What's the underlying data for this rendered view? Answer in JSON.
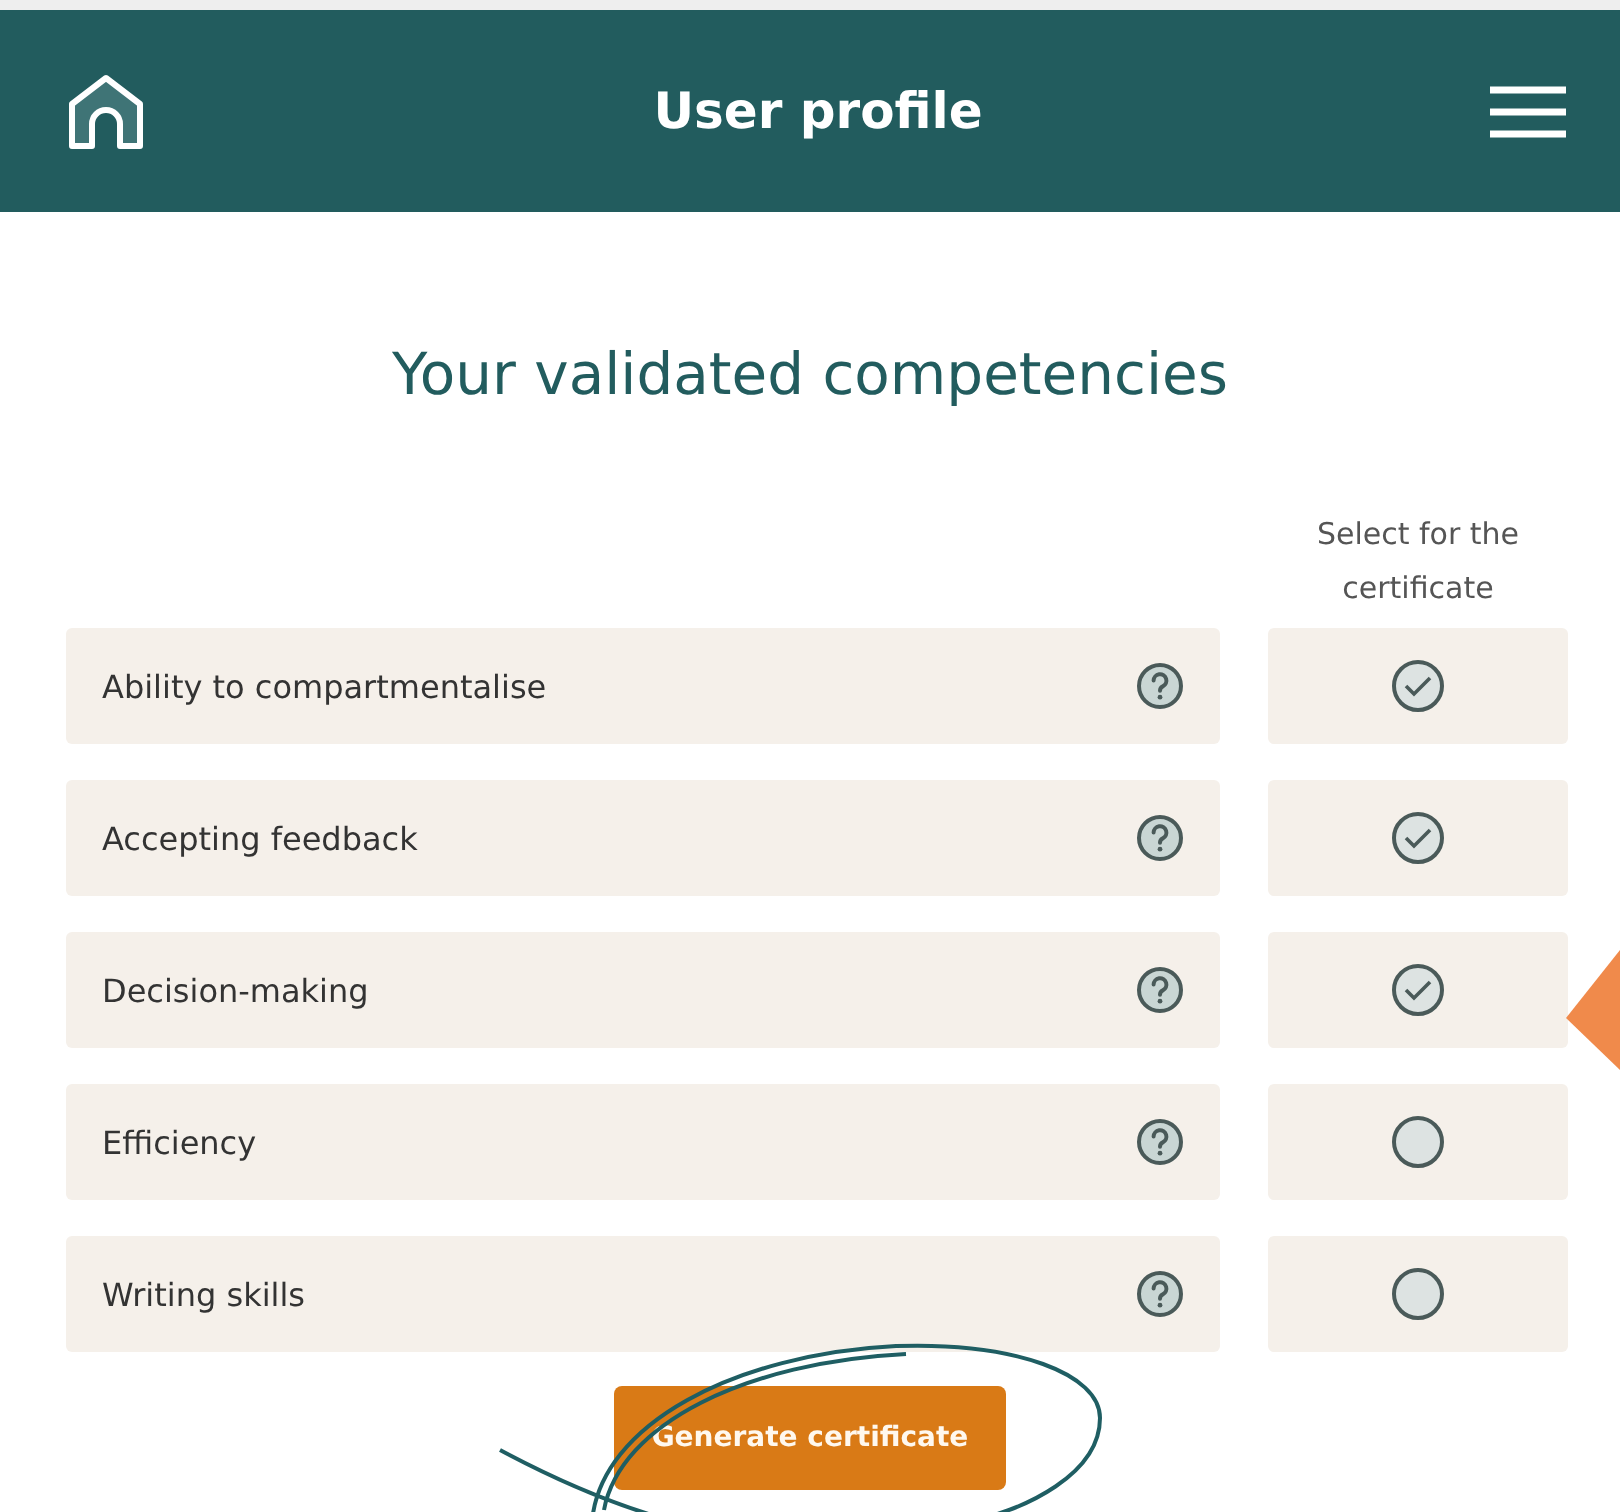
{
  "header": {
    "title": "User profile"
  },
  "heading": "Your validated competencies",
  "select_column": {
    "label": "Select for the certificate"
  },
  "competencies": [
    {
      "name": "Ability to compartmentalise",
      "checked": true
    },
    {
      "name": "Accepting feedback",
      "checked": true
    },
    {
      "name": "Decision-making",
      "checked": true
    },
    {
      "name": "Efficiency",
      "checked": false
    },
    {
      "name": "Writing skills",
      "checked": false
    }
  ],
  "button": "Generate certificate"
}
